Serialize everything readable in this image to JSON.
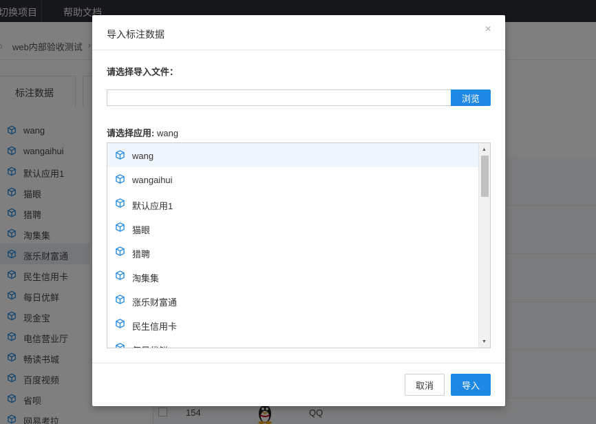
{
  "topbar": {
    "switch_project": "切换项目",
    "help_docs": "帮助文档"
  },
  "breadcrumb": {
    "current": "web内部验收测试",
    "separator": "›"
  },
  "sidebar": {
    "tab_label": "标注数据",
    "items": [
      {
        "label": "wang"
      },
      {
        "label": "wangaihui"
      },
      {
        "label": "默认应用1"
      },
      {
        "label": "猫眼"
      },
      {
        "label": "猎聘"
      },
      {
        "label": "淘集集"
      },
      {
        "label": "涨乐财富通"
      },
      {
        "label": "民生信用卡"
      },
      {
        "label": "每日优鲜"
      },
      {
        "label": "现金宝"
      },
      {
        "label": "电信营业厅"
      },
      {
        "label": "畅读书城"
      },
      {
        "label": "百度视频"
      },
      {
        "label": "省呗"
      },
      {
        "label": "网易考拉"
      }
    ]
  },
  "table_row": {
    "number": "154",
    "name": "QQ"
  },
  "modal": {
    "title": "导入标注数据",
    "close": "×",
    "file_label": "请选择导入文件：",
    "file_value": "",
    "browse_label": "浏览",
    "app_label_prefix": "请选择应用:",
    "app_selected": "wang",
    "apps": [
      {
        "label": "wang"
      },
      {
        "label": "wangaihui"
      },
      {
        "label": "默认应用1"
      },
      {
        "label": "猫眼"
      },
      {
        "label": "猎聘"
      },
      {
        "label": "淘集集"
      },
      {
        "label": "涨乐财富通"
      },
      {
        "label": "民生信用卡"
      },
      {
        "label": "每日优鲜"
      }
    ],
    "cancel_label": "取消",
    "import_label": "导入"
  },
  "colors": {
    "accent": "#1e88e5",
    "topbar": "#2b2f36",
    "overlay": "rgba(0,0,0,0.5)",
    "selected_row": "#f0f6fd"
  },
  "icons": {
    "app_icon": "cube-icon",
    "close_icon": "close-icon",
    "home_icon": "home-icon"
  }
}
